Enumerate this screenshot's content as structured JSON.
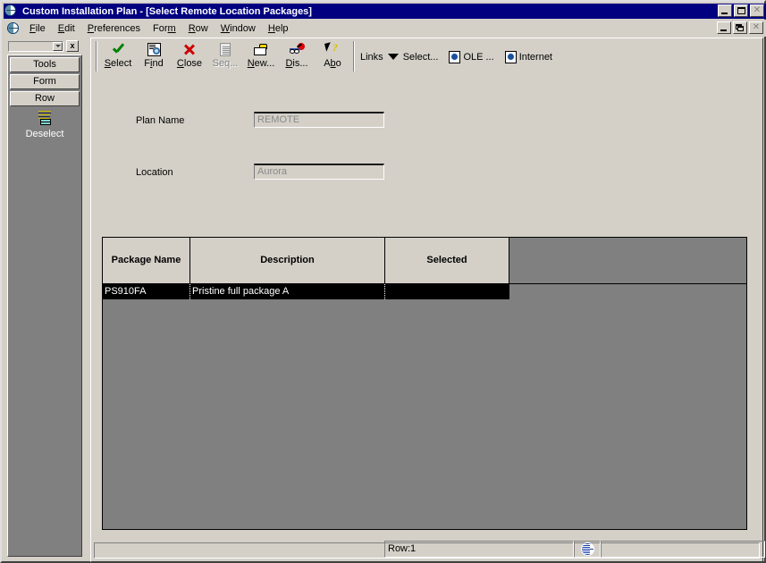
{
  "window": {
    "title": "Custom Installation Plan - [Select Remote Location Packages]",
    "icon": "globe-icon",
    "controls": {
      "minimize": "minimize-button",
      "maximize": "maximize-button",
      "close": "close-button"
    },
    "mdi_controls": {
      "minimize": "mdi-minimize-button",
      "restore": "mdi-restore-button",
      "close": "mdi-close-button"
    }
  },
  "menu": {
    "items": [
      {
        "label": "File",
        "mnemonic": "F"
      },
      {
        "label": "Edit",
        "mnemonic": "E"
      },
      {
        "label": "Preferences",
        "mnemonic": "P"
      },
      {
        "label": "Form",
        "mnemonic": "m"
      },
      {
        "label": "Row",
        "mnemonic": "R"
      },
      {
        "label": "Window",
        "mnemonic": "W"
      },
      {
        "label": "Help",
        "mnemonic": "H"
      }
    ]
  },
  "sidebar": {
    "combo_value": "",
    "close_label": "x",
    "buttons": [
      {
        "label": "Tools"
      },
      {
        "label": "Form"
      },
      {
        "label": "Row"
      }
    ],
    "action": {
      "label": "Deselect",
      "icon": "deselect-icon"
    }
  },
  "toolbar": {
    "buttons": [
      {
        "label": "Select",
        "mnemonic": "S",
        "icon": "check-icon",
        "disabled": false
      },
      {
        "label": "Find",
        "mnemonic": "i",
        "icon": "find-icon",
        "disabled": false
      },
      {
        "label": "Close",
        "mnemonic": "C",
        "icon": "close-x-icon",
        "disabled": false
      },
      {
        "label": "Seq...",
        "mnemonic": "q",
        "icon": "sequence-icon",
        "disabled": true
      },
      {
        "label": "New...",
        "mnemonic": "N",
        "icon": "new-folder-icon",
        "disabled": false
      },
      {
        "label": "Dis...",
        "mnemonic": "D",
        "icon": "display-icon",
        "disabled": false
      },
      {
        "label": "Abo",
        "mnemonic": "b",
        "icon": "about-cursor-icon",
        "disabled": false
      }
    ],
    "links_label": "Links",
    "links_dropdown_icon": "chevron-down-icon",
    "links": [
      {
        "label": "Select...",
        "icon": null
      },
      {
        "label": "OLE ...",
        "icon": "ole-icon"
      },
      {
        "label": "Internet",
        "icon": "internet-icon"
      }
    ]
  },
  "form": {
    "fields": [
      {
        "label": "Plan Name",
        "value": "REMOTE",
        "readonly": true
      },
      {
        "label": "Location",
        "value": "Aurora",
        "readonly": true
      }
    ]
  },
  "grid": {
    "columns": [
      "Package Name",
      "Description",
      "Selected"
    ],
    "rows": [
      {
        "package_name": "PS910FA",
        "description": "Pristine full package A",
        "selected": ""
      }
    ]
  },
  "status": {
    "row_indicator": "Row:1",
    "globe_icon": "internet-globe-icon"
  },
  "colors": {
    "titlebar": "#000080",
    "face": "#d4d0c8",
    "grid_background": "#808080",
    "selected_row_bg": "#000000",
    "selected_row_fg": "#ffffff",
    "disabled_text": "#808080"
  }
}
